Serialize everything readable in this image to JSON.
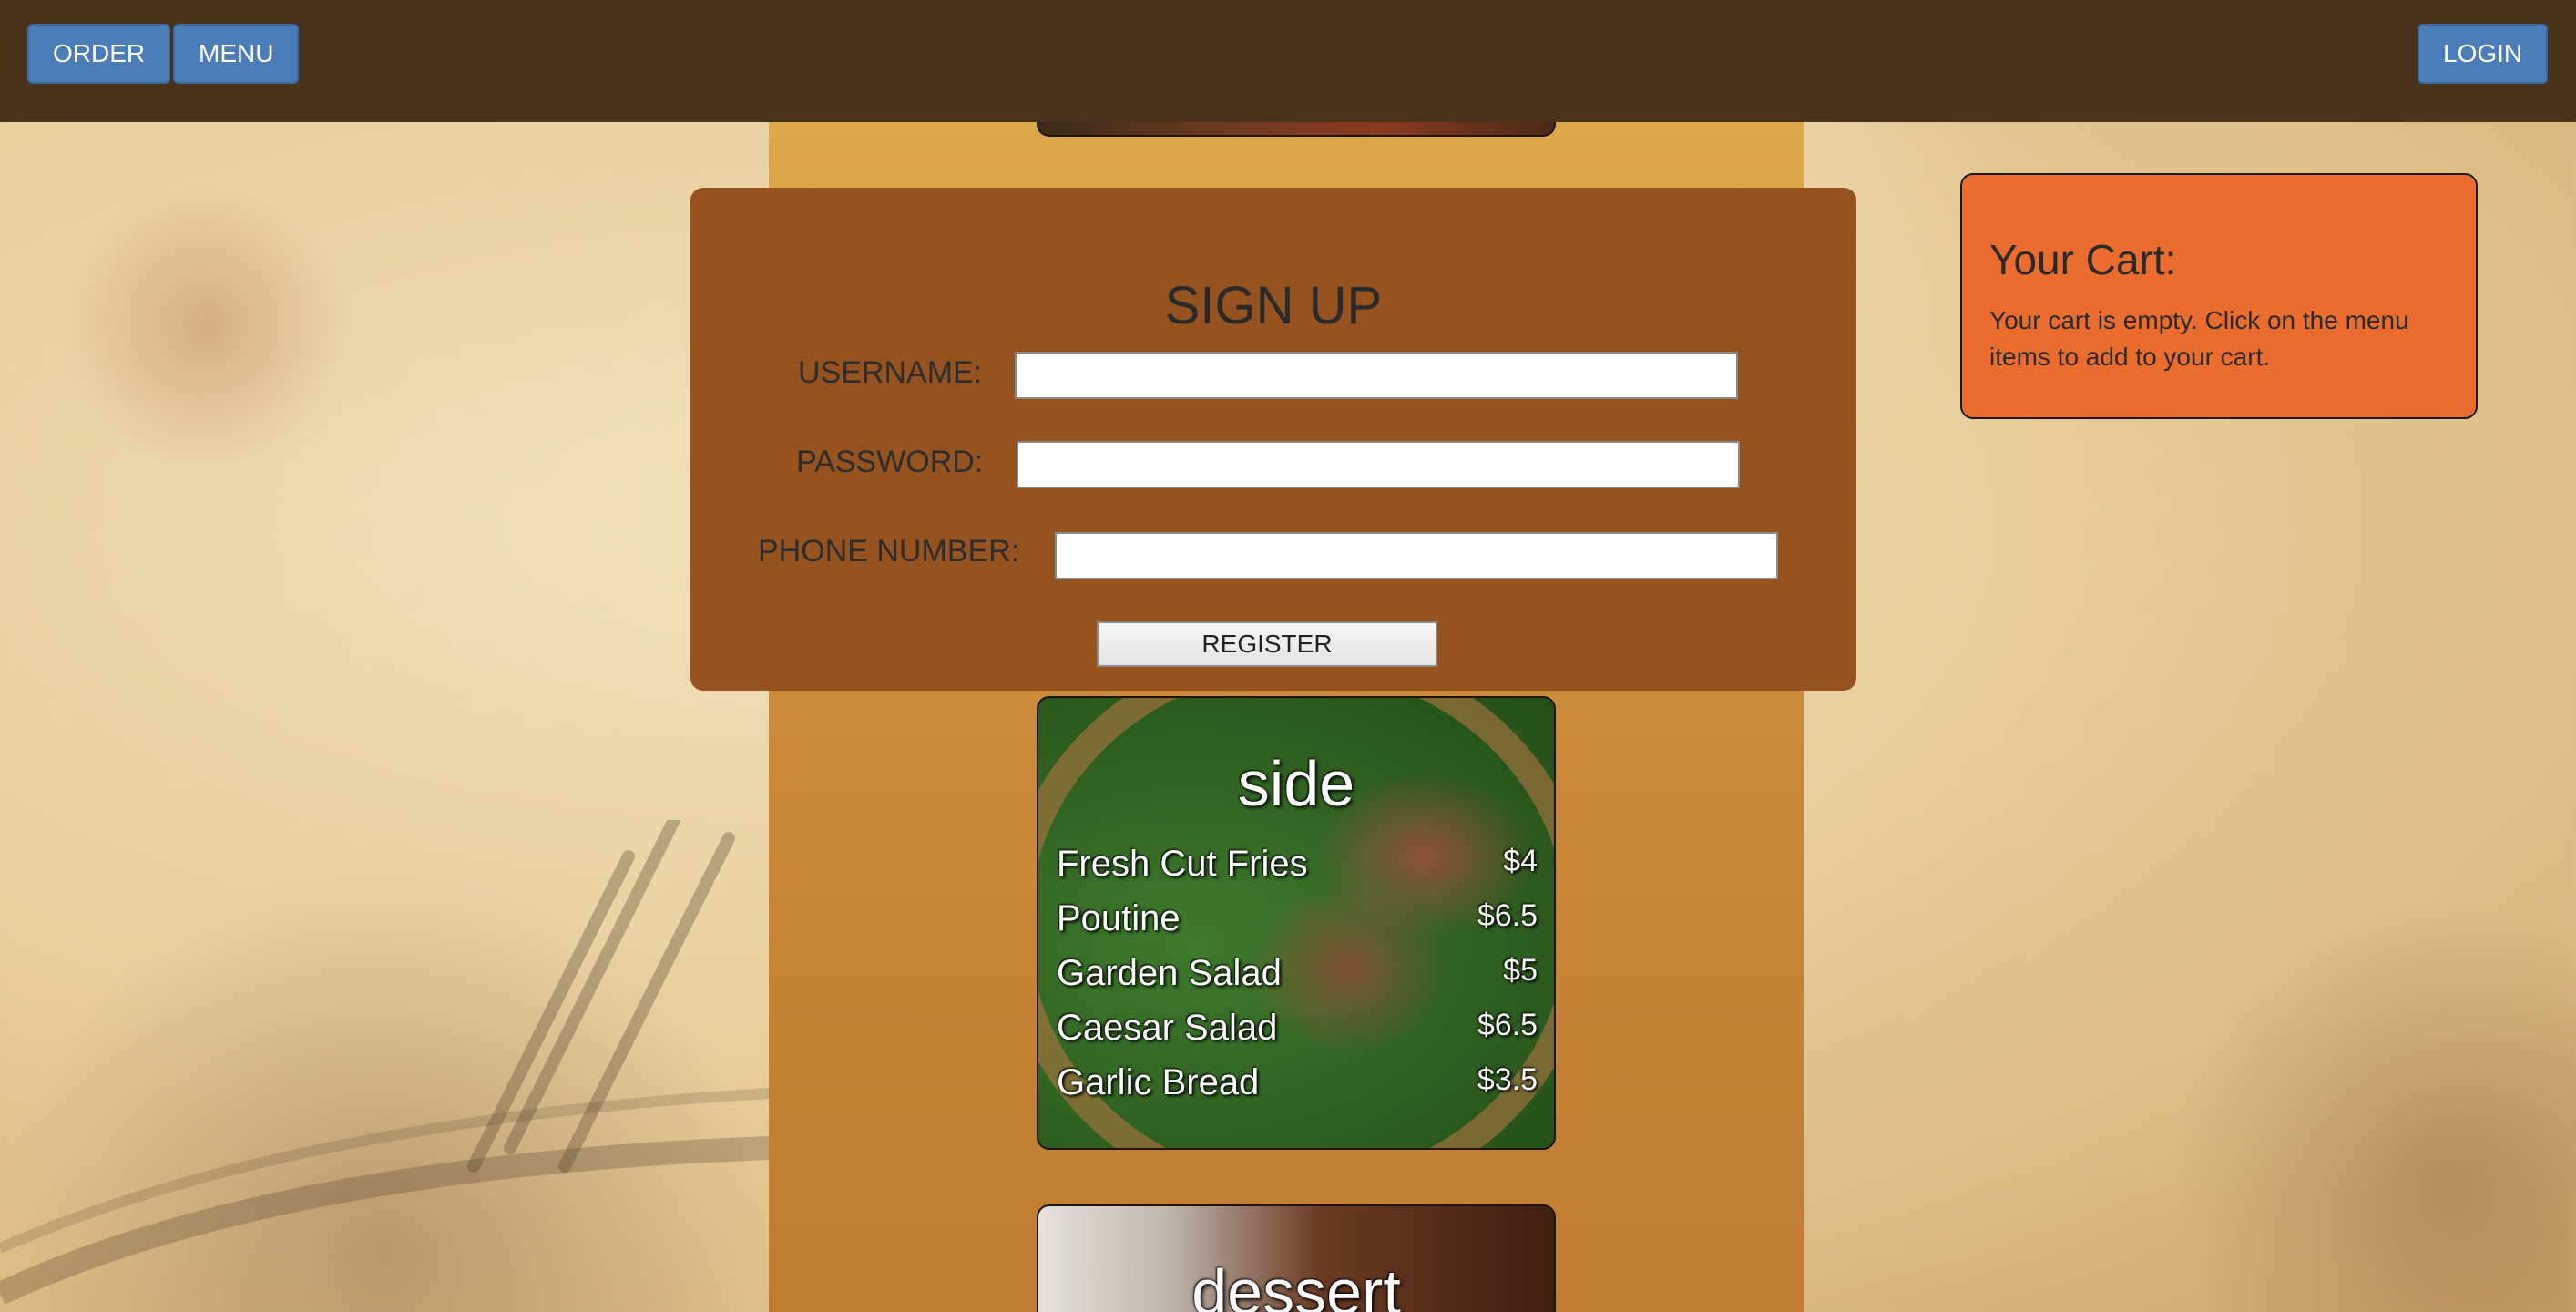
{
  "nav": {
    "order_label": "ORDER",
    "menu_label": "MENU",
    "login_label": "LOGIN"
  },
  "signup": {
    "title": "SIGN UP",
    "username_label": "USERNAME:",
    "password_label": "PASSWORD:",
    "phone_label": "PHONE NUMBER:",
    "username_value": "",
    "password_value": "",
    "phone_value": "",
    "register_label": "REGISTER"
  },
  "cart": {
    "title": "Your Cart:",
    "empty_text": "Your cart is empty. Click on the menu items to add to your cart."
  },
  "menu": {
    "side": {
      "title": "side",
      "items": [
        {
          "name": "Fresh Cut Fries",
          "price": "$4"
        },
        {
          "name": "Poutine",
          "price": "$6.5"
        },
        {
          "name": "Garden Salad",
          "price": "$5"
        },
        {
          "name": "Caesar Salad",
          "price": "$6.5"
        },
        {
          "name": "Garlic Bread",
          "price": "$3.5"
        }
      ]
    },
    "dessert": {
      "title": "dessert"
    }
  },
  "colors": {
    "topbar": "#4a331d",
    "nav_button": "#4a7db8",
    "signup_panel": "#96531f",
    "cart_panel": "#eb6c2f",
    "column": "#dda84a"
  }
}
